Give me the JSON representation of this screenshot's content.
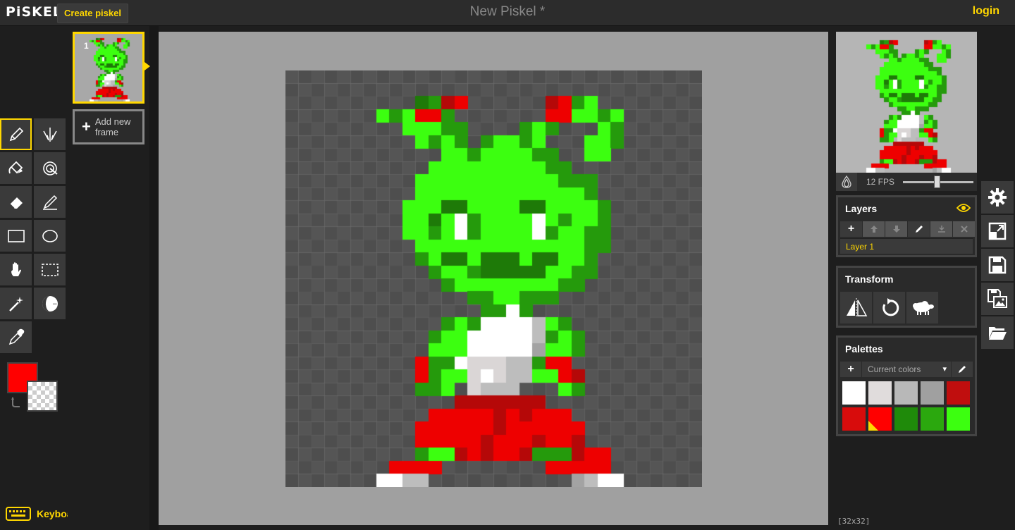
{
  "app": {
    "logo": "PiSKEL",
    "title": "New Piskel *",
    "create_label": "Create piskel",
    "login_label": "login"
  },
  "frames": {
    "items": [
      {
        "number": "1"
      }
    ],
    "add_label": "Add new frame"
  },
  "tools": [
    {
      "name": "pen-tool",
      "icon": "pen-icon",
      "selected": true
    },
    {
      "name": "vertical-mirror-pen-tool",
      "icon": "mirror-pen-icon"
    },
    {
      "name": "paint-bucket-tool",
      "icon": "bucket-icon"
    },
    {
      "name": "paint-all-same-color-tool",
      "icon": "magic-bucket-icon"
    },
    {
      "name": "eraser-tool",
      "icon": "eraser-icon"
    },
    {
      "name": "stroke-tool",
      "icon": "stroke-icon"
    },
    {
      "name": "rectangle-tool",
      "icon": "rectangle-icon"
    },
    {
      "name": "circle-tool",
      "icon": "circle-icon"
    },
    {
      "name": "move-tool",
      "icon": "hand-icon"
    },
    {
      "name": "rectangle-selection-tool",
      "icon": "selection-icon"
    },
    {
      "name": "shape-selection-tool",
      "icon": "magic-wand-icon"
    },
    {
      "name": "lighten-tool",
      "icon": "lighten-icon"
    },
    {
      "name": "color-picker-tool",
      "icon": "eyedropper-icon"
    }
  ],
  "colors": {
    "primary": "#ff0000",
    "secondary": "transparent"
  },
  "footer": {
    "shortcuts_label": "Keyboard shortcuts",
    "resolution": "[32x32]"
  },
  "preview": {
    "fps_label": "12 FPS",
    "fps": 12
  },
  "layers": {
    "title": "Layers",
    "items": [
      {
        "name": "Layer 1",
        "selected": true
      }
    ]
  },
  "transform": {
    "title": "Transform"
  },
  "palettes": {
    "title": "Palettes",
    "selected_palette": "Current colors",
    "colors": [
      "#ffffff",
      "#e0dcdc",
      "#b8b8b8",
      "#a0a0a0",
      "#c00e0e",
      "#d80c0c",
      "#ff0000",
      "#1f8a0a",
      "#2ba80e",
      "#3cff10"
    ],
    "selected_index": 6
  },
  "sprite": {
    "width": 32,
    "height": 32,
    "palette": {
      "G": "#3cff10",
      "D": "#259a0c",
      "E": "#1e7a08",
      "R": "#ee0000",
      "r": "#b50808",
      "W": "#ffffff",
      "w": "#dad6d6",
      "s": "#bdbdbd",
      "x": "#a3a3a3"
    },
    "rows": [
      "................................",
      "................................",
      "..........EDrR......rRDG........",
      ".......GDGRRD.......RRGGDG......",
      ".........GGGDD....DGD...GD......",
      "..........GDGD.DGGDG...GGD......",
      "............GGDGGGGDD..GG.......",
      "...........GGGGGGGGGDD..........",
      "..........GGGGGGGGGGGDDD........",
      "..........GGGGGGGGGGGGGD........",
      ".........GGGEEGGGGEEGGGGD.......",
      ".........GGEGWDGGGGWGDGGD.......",
      ".........GGDGWDGGGGWDGGDD.......",
      "..........GGGGGGGGGGGGGDD.......",
      "..........DGEEGEEEGEEGGD........",
      "...........DGGDEEEEEGGDD........",
      "............DGGGGGGGGDD.........",
      "..............DDGGDDD...........",
      "...............DDWD.............",
      "............DGDWWWWsGD..........",
      "...........DGGWWWWWsDGD.........",
      "...........GGGWWWWWxGGD.........",
      "..........RDDWwwwssDRR..........",
      "..........RDGGwWwssGGRr.........",
      "..........DDG.wsss...GD.........",
      ".............rrrrrrr............",
      "...........RRRRRrRrRRR..........",
      "..........RRRRRRrRRRRRR.........",
      "..........RRRRRrRRRrRRr.........",
      "..........DGGrRrRRrDDDrRR.......",
      "........RRRR........RRRRR.......",
      ".......WWss...........xsWW......"
    ]
  }
}
